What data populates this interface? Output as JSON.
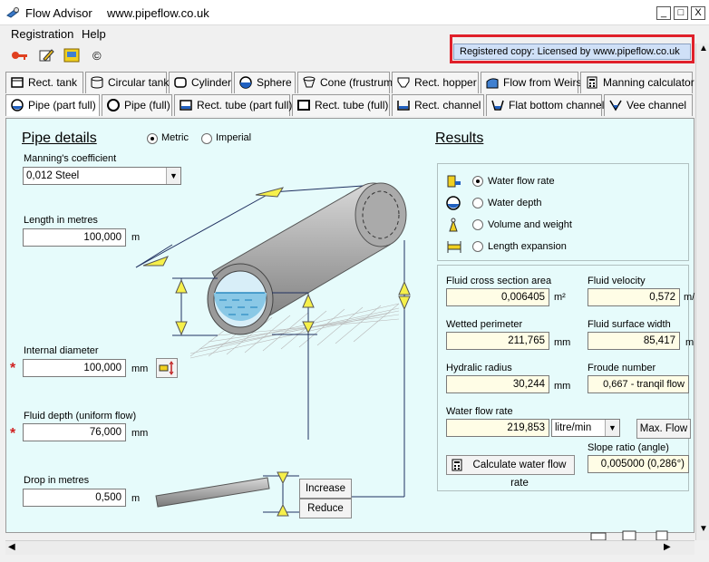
{
  "window": {
    "title": "Flow Advisor",
    "url": "www.pipeflow.co.uk",
    "minimize": "_",
    "maximize": "□",
    "close": "X"
  },
  "menu": [
    "Registration",
    "Help"
  ],
  "toolbar": {
    "copyright": "©",
    "registered": "Registered copy: Licensed by www.pipeflow.co.uk"
  },
  "tabs_row1": [
    "Rect. tank",
    "Circular tank",
    "Cylinder",
    "Sphere",
    "Cone (frustrum)",
    "Rect. hopper",
    "Flow from Weirs",
    "Manning calculator"
  ],
  "tabs_row2": [
    "Pipe (part full)",
    "Pipe (full)",
    "Rect. tube (part full)",
    "Rect. tube (full)",
    "Rect. channel",
    "Flat bottom channel",
    "Vee channel"
  ],
  "pipe": {
    "heading": "Pipe details",
    "units": {
      "metric": "Metric",
      "imperial": "Imperial",
      "selected": "Metric"
    },
    "manning_label": "Manning's coefficient",
    "manning_value": "0,012  Steel",
    "length_label": "Length  in metres",
    "length_value": "100,000",
    "length_unit": "m",
    "diameter_label": "Internal diameter",
    "diameter_value": "100,000",
    "diameter_unit": "mm",
    "depth_label": "Fluid depth (uniform flow)",
    "depth_value": "76,000",
    "depth_unit": "mm",
    "drop_label": "Drop  in metres",
    "drop_value": "0,500",
    "drop_unit": "m",
    "required_mark": "*",
    "increase": "Increase",
    "reduce": "Reduce"
  },
  "results": {
    "heading": "Results",
    "options": [
      "Water flow rate",
      "Water depth",
      "Volume and weight",
      "Length expansion"
    ],
    "selected": "Water flow rate",
    "area_label": "Fluid cross section area",
    "area_value": "0,006405",
    "area_unit": "m²",
    "velocity_label": "Fluid velocity",
    "velocity_value": "0,572",
    "velocity_unit": "m/",
    "perimeter_label": "Wetted perimeter",
    "perimeter_value": "211,765",
    "perimeter_unit": "mm",
    "surface_label": "Fluid surface width",
    "surface_value": "85,417",
    "surface_unit": "m",
    "radius_label": "Hydralic radius",
    "radius_value": "30,244",
    "radius_unit": "mm",
    "froude_label": "Froude number",
    "froude_value": "0,667 - tranqil flow",
    "flow_label": "Water flow rate",
    "flow_value": "219,853",
    "flow_unit": "litre/min",
    "max_flow": "Max. Flow",
    "slope_label": "Slope ratio (angle)",
    "slope_value": "0,005000 (0,286°)",
    "calc_button": "Calculate water flow rate"
  },
  "colors": {
    "panel": "#e6fbfb",
    "highlight": "#e0202a",
    "arrow": "#f6f04a",
    "pipe": "#9c9c9c"
  }
}
